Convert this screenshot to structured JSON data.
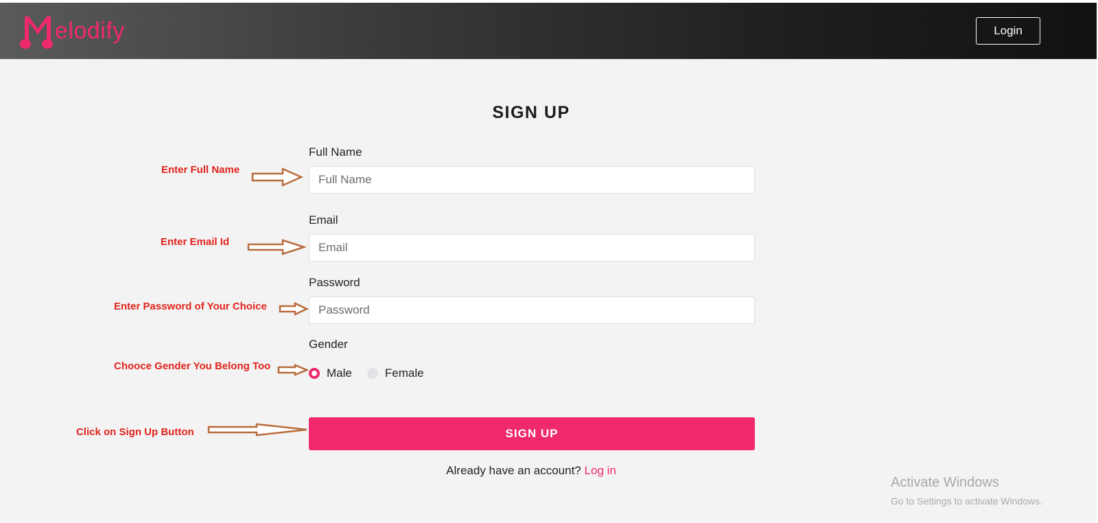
{
  "header": {
    "logo_text": "elodify",
    "login_label": "Login",
    "accent_color": "#f0296d"
  },
  "form": {
    "title": "SIGN UP",
    "full_name": {
      "label": "Full Name",
      "placeholder": "Full Name"
    },
    "email": {
      "label": "Email",
      "placeholder": "Email"
    },
    "password": {
      "label": "Password",
      "placeholder": "Password"
    },
    "gender": {
      "label": "Gender",
      "options": [
        "Male",
        "Female"
      ],
      "selected": "Male"
    },
    "submit_label": "SIGN UP",
    "already_text": "Already have an account?",
    "login_link": "Log in"
  },
  "annotations": {
    "full_name": "Enter Full Name",
    "email": "Enter Email Id",
    "password": "Enter Password of Your Choice",
    "gender": "Chooce Gender You Belong Too",
    "signup": "Click on Sign Up Button"
  },
  "watermark": {
    "line1": "Activate Windows",
    "line2": "Go to Settings to activate Windows."
  }
}
